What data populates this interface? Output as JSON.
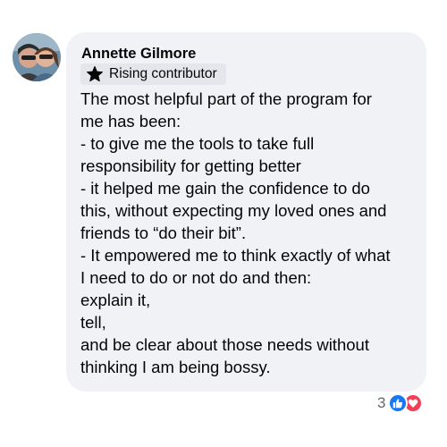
{
  "comment": {
    "author": "Annette Gilmore",
    "badge": {
      "icon": "star-icon",
      "label": "Rising contributor"
    },
    "lines": [
      "The most helpful part of the program for",
      "me has been:",
      "- to give me the tools to take full",
      "responsibility for getting better",
      "- it helped me gain the confidence to do",
      "this, without expecting my loved ones and",
      "friends to “do their bit”.",
      "- It empowered me to think exactly of what",
      "I need to do or not do and then:",
      "explain it,",
      "tell,",
      "and be clear about those needs without",
      "thinking I am being bossy."
    ]
  },
  "reactions": {
    "count": "3",
    "types": [
      "like-icon",
      "love-icon"
    ],
    "colors": {
      "like": "#1877f2",
      "love": "#f33e58"
    }
  },
  "colors": {
    "bubble": "#f0f2f5",
    "badge": "#e4e6eb",
    "text": "#050505",
    "muted": "#65676b"
  }
}
